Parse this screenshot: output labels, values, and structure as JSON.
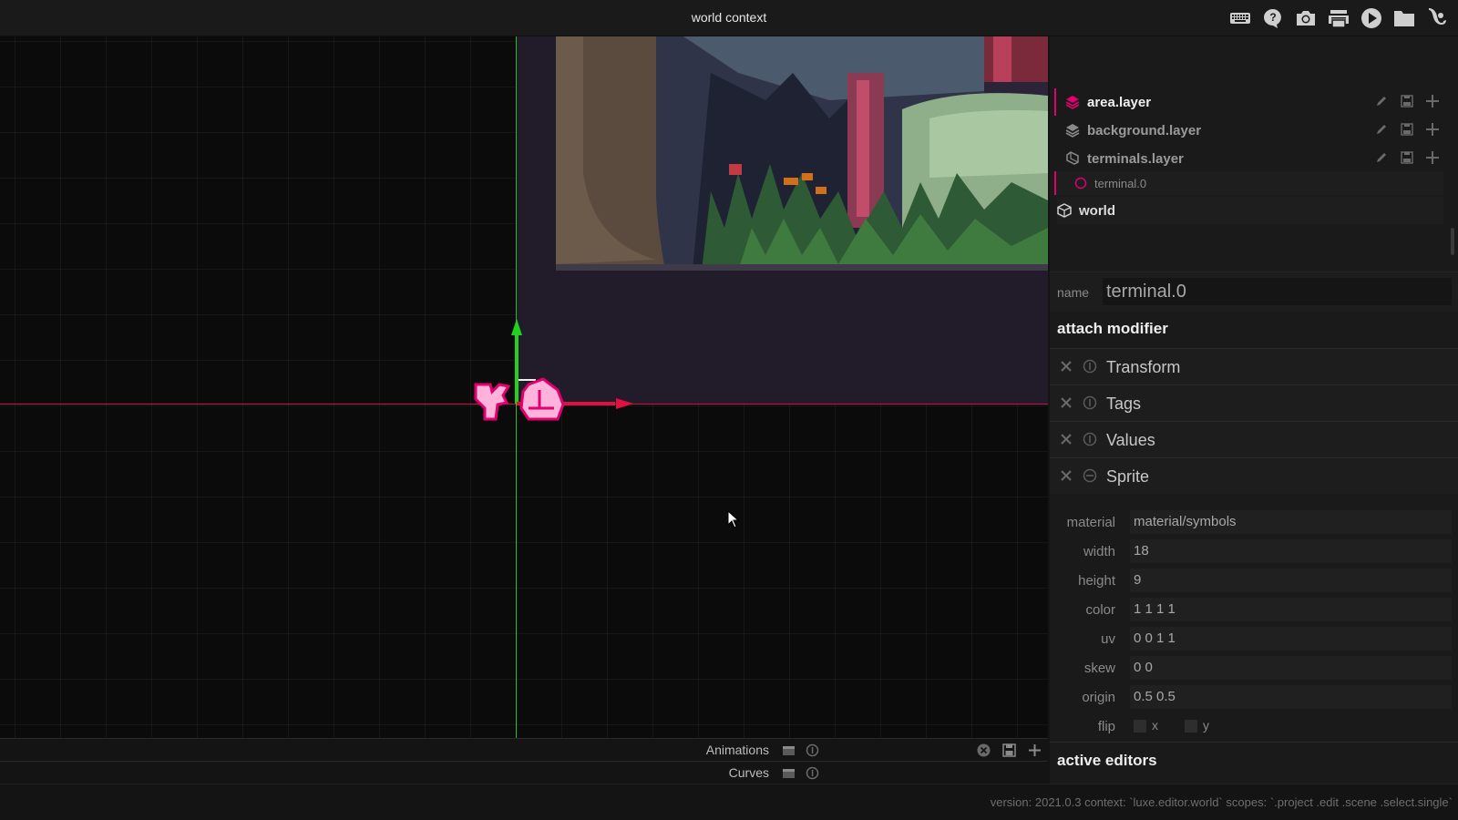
{
  "window": {
    "title": "world context"
  },
  "toolbar": {
    "icons": [
      "keyboard-icon",
      "help-icon",
      "camera-icon",
      "printer-icon",
      "play-icon",
      "folder-icon",
      "luxe-logo-icon"
    ]
  },
  "outliner": {
    "items": [
      {
        "label": "area.layer",
        "type": "layer",
        "active": true
      },
      {
        "label": "background.layer",
        "type": "layer",
        "active": false
      },
      {
        "label": "terminals.layer",
        "type": "layer-open",
        "active": false
      },
      {
        "label": "terminal.0",
        "type": "entity",
        "selected": true
      },
      {
        "label": "world",
        "type": "world"
      }
    ]
  },
  "inspector": {
    "name_label": "name",
    "name_value": "terminal.0",
    "attach_title": "attach modifier",
    "modifiers": [
      {
        "name": "Transform"
      },
      {
        "name": "Tags"
      },
      {
        "name": "Values"
      },
      {
        "name": "Sprite"
      }
    ],
    "sprite": {
      "material_label": "material",
      "material": "material/symbols",
      "width_label": "width",
      "width": "18",
      "height_label": "height",
      "height": "9",
      "color_label": "color",
      "color": "1 1 1 1",
      "uv_label": "uv",
      "uv": "0 0 1 1",
      "skew_label": "skew",
      "skew": "0 0",
      "origin_label": "origin",
      "origin": "0.5 0.5",
      "flip_label": "flip",
      "flip_x": "x",
      "flip_y": "y"
    },
    "active_editors_title": "active editors"
  },
  "panels": {
    "animations": "Animations",
    "curves": "Curves"
  },
  "status": {
    "text": "version: 2021.0.3 context: `luxe.editor.world` scopes: `.project .edit .scene .select.single`"
  },
  "colors": {
    "accent": "#e0006e",
    "axis_x": "#d01040",
    "axis_y": "#22c020"
  }
}
